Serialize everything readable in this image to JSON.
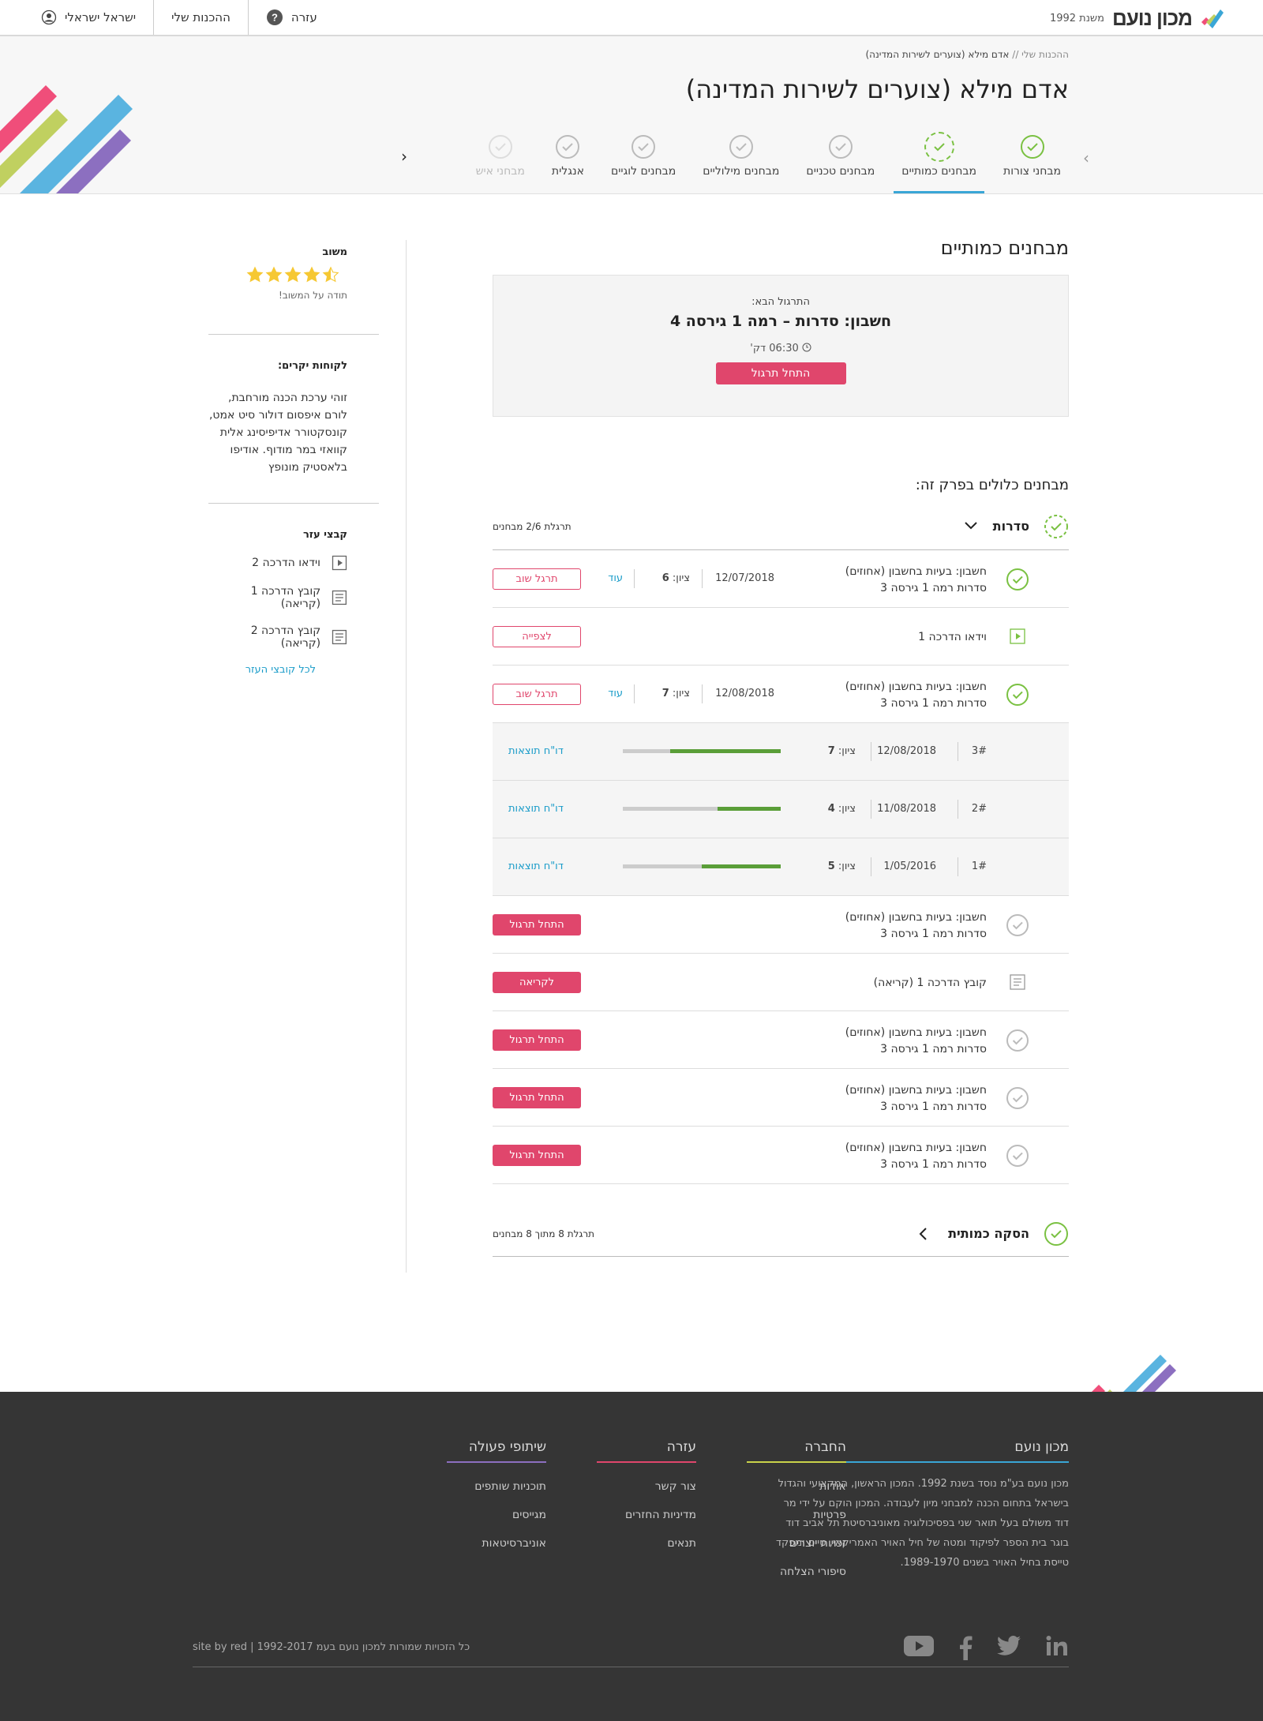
{
  "topbar": {
    "logo_text": "מכון נועם",
    "logo_since": "משנת 1992",
    "nav": [
      {
        "label": "עזרה",
        "icon": "help-icon"
      },
      {
        "label": "ההכנות שלי",
        "icon": ""
      },
      {
        "label": "ישראל ישראלי",
        "icon": "user-icon"
      }
    ]
  },
  "breadcrumb": {
    "parent": "ההכנות שלי //",
    "current": "אדם מילא (צוערים לשירות המדינה)"
  },
  "page_title": "אדם מילא (צוערים לשירות המדינה)",
  "tabs": [
    {
      "label": "מבחני צורות",
      "state": "done"
    },
    {
      "label": "מבחנים כמותיים",
      "state": "active"
    },
    {
      "label": "מבחנים טכניים",
      "state": "todo"
    },
    {
      "label": "מבחנים מילוליים",
      "state": "todo"
    },
    {
      "label": "מבחנים לוגיים",
      "state": "todo"
    },
    {
      "label": "אנגלית",
      "state": "todo"
    },
    {
      "label": "מבחני איש",
      "state": "faded"
    }
  ],
  "main": {
    "section_title": "מבחנים כמותיים",
    "next": {
      "label": "התרגול הבא:",
      "title": "חשבון: סדרות – רמה 1 גירסה 4",
      "time": "06:30 דק'",
      "button": "התחל תרגול"
    },
    "list_title": "מבחנים כלולים בפרק זה:",
    "group1": {
      "title": "סדרות",
      "progress": "תרגלת 2/6 מבחנים"
    },
    "rows": [
      {
        "type": "test",
        "done": true,
        "line1": "חשבון: בעיות בחשבון (אחוזים)",
        "line2": "סדרות רמה 1 גירסה 3",
        "date": "12/07/2018",
        "score_label": "ציון:",
        "score": "6",
        "more": "עוד",
        "button": "תרגל שוב",
        "btn": "outline"
      },
      {
        "type": "video",
        "line1": "וידאו הדרכה 1",
        "button": "לצפייה",
        "btn": "outline"
      },
      {
        "type": "test",
        "done": true,
        "line1": "חשבון: בעיות בחשבון (אחוזים)",
        "line2": "סדרות רמה 1 גירסה 3",
        "date": "12/08/2018",
        "score_label": "ציון:",
        "score": "7",
        "more": "עוד",
        "button": "תרגל שוב",
        "btn": "outline"
      },
      {
        "type": "attempt",
        "num": "3#",
        "date": "12/08/2018",
        "score_label": "ציון:",
        "score": "7",
        "fill": 0.7,
        "report": "דו\"ח תוצאות"
      },
      {
        "type": "attempt",
        "num": "2#",
        "date": "11/08/2018",
        "score_label": "ציון:",
        "score": "4",
        "fill": 0.4,
        "report": "דו\"ח תוצאות"
      },
      {
        "type": "attempt",
        "num": "1#",
        "date": "1/05/2016",
        "score_label": "ציון:",
        "score": "5",
        "fill": 0.5,
        "report": "דו\"ח תוצאות"
      },
      {
        "type": "test",
        "done": false,
        "line1": "חשבון: בעיות בחשבון (אחוזים)",
        "line2": "סדרות רמה 1 גירסה 3",
        "button": "התחל תרגול",
        "btn": "solid"
      },
      {
        "type": "doc",
        "line1": "קובץ הדרכה 1 (קריאה)",
        "button": "לקריאה",
        "btn": "solid"
      },
      {
        "type": "test",
        "done": false,
        "line1": "חשבון: בעיות בחשבון (אחוזים)",
        "line2": "סדרות רמה 1 גירסה 3",
        "button": "התחל תרגול",
        "btn": "solid"
      },
      {
        "type": "test",
        "done": false,
        "line1": "חשבון: בעיות בחשבון (אחוזים)",
        "line2": "סדרות רמה 1 גירסה 3",
        "button": "התחל תרגול",
        "btn": "solid"
      },
      {
        "type": "test",
        "done": false,
        "line1": "חשבון: בעיות בחשבון (אחוזים)",
        "line2": "סדרות רמה 1 גירסה 3",
        "button": "התחל תרגול",
        "btn": "solid"
      }
    ],
    "group2": {
      "title": "הסקה כמותית",
      "progress": "תרגלת 8 מתוך 8 מבחנים"
    }
  },
  "sidebar": {
    "feedback_title": "משוב",
    "rating": 4.5,
    "feedback_thanks": "תודה על המשוב!",
    "clients_title": "לקוחות יקרים:",
    "clients_text": "זוהי ערכת הכנה מורחבת, לורם איפסום דולור סיט אמט, קונסקטורר אדיפיסינג אלית קוואזי במר מודוף. אודיפו בלאסטיק מונופץ",
    "files_title": "קבצי עזר",
    "files": [
      {
        "label": "וידאו הדרכה 2",
        "icon": "video-icon"
      },
      {
        "label": "קובץ הדרכה 1 (קריאה)",
        "icon": "document-icon"
      },
      {
        "label": "קובץ הדרכה 2 (קריאה)",
        "icon": "document-icon"
      }
    ],
    "all_files_link": "לכל קובצי העזר"
  },
  "footer": {
    "about_title": "מכון נועם",
    "about_text": "מכון נועם בע\"מ נוסד בשנת 1992. המכון הראשון, המקצועי והגדול בישראל בתחום הכנה למבחני מיון לעבודה. המכון הוקם על ידי מר דוד משולם בעל תואר שני בפסיכולוגיה מאוניברסיטת תל אביב דוד בוגר בית הספר לפיקוד ומטה של חיל האויר האמריקאי, טייס ומפקד טייסת בחיל האויר בשנים 1989-1970.",
    "columns": [
      {
        "title": "החברה",
        "color": "#c9d24a",
        "links": [
          "אודות",
          "פרטיות",
          "זכויות יוצרים",
          "סיפורי הצלחה"
        ]
      },
      {
        "title": "עזרה",
        "color": "#e0466c",
        "links": [
          "צור קשר",
          "מדיניות החזרים",
          "תנאים"
        ]
      },
      {
        "title": "שיתופי פעולה",
        "color": "#8c6fc0",
        "links": [
          "תוכניות שותפים",
          "מגייסים",
          "אוניברסיטאות"
        ]
      }
    ],
    "copyright": "site by red   |   1992-2017 כל הזכויות שמורות למכון נועם בעמ",
    "social": [
      "linkedin-icon",
      "twitter-icon",
      "facebook-icon",
      "youtube-icon"
    ]
  },
  "colors": {
    "accent_green": "#7ac142",
    "accent_pink": "#e0466c",
    "accent_blue": "#3aa6d6",
    "footer_bg": "#353535"
  }
}
